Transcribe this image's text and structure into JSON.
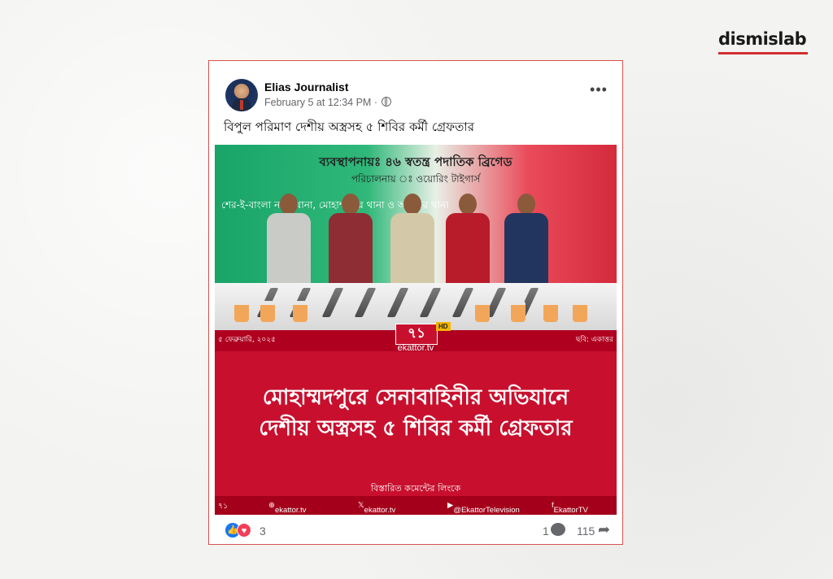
{
  "brand": {
    "name": "dismislab"
  },
  "post": {
    "author": "Elias Journalist",
    "timestamp": "February 5 at 12:34 PM",
    "separator": "·",
    "caption": "বিপুল পরিমাণ দেশীয় অস্ত্রসহ ৫ শিবির কর্মী গ্রেফতার"
  },
  "media": {
    "banner_top": "ব্যবস্থাপনায়ঃ ৪৬ স্বতন্ত্র পদাতিক ব্রিগেড",
    "banner_2": "পরিচালনায় ঃ ওয়োরিং টাইগার্স",
    "banner_3": "শের-ই-বাংলা নগর থানা, মোহাম্মদপুর থানা ও আদাবর থানা",
    "date_left": "৫ ফেব্রুয়ারি, ২০২৫",
    "credit_right": "ছবি: একাত্তর",
    "logo": "৭১",
    "logo_hd": "HD",
    "logo_sub": "ekattor.tv",
    "headline_line1": "মোহাম্মদপুরে সেনাবাহিনীর অভিযানে",
    "headline_line2": "দেশীয় অস্ত্রসহ ৫ শিবির কর্মী গ্রেফতার",
    "comment_link": "বিস্তারিত কমেন্টের লিংকে",
    "social_web": "ekattor.tv",
    "social_x": "ekattor.tv",
    "social_yt": "@EkattorTelevision",
    "social_fb": "EkattorTV"
  },
  "footer": {
    "reaction_count": "3",
    "comment_count": "1",
    "share_count": "115"
  },
  "colors": {
    "accent": "#d9534f",
    "brand_red": "#c8102e",
    "fb_blue": "#1877f2"
  },
  "icons": [
    "globe-icon",
    "more-icon",
    "like-icon",
    "love-icon",
    "comment-icon",
    "share-icon"
  ]
}
